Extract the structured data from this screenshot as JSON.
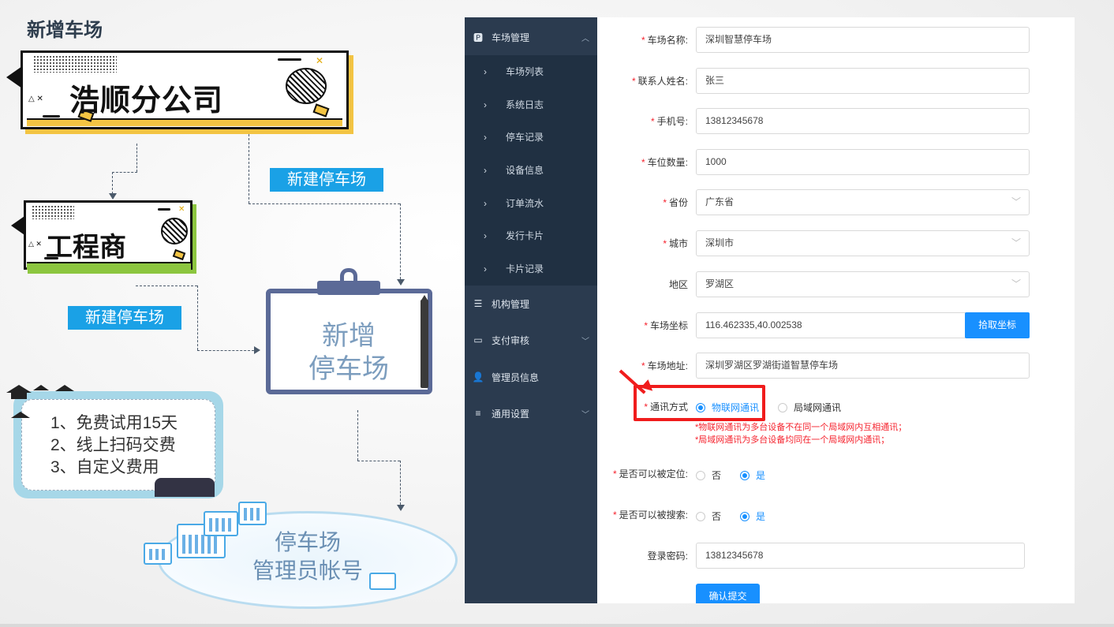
{
  "slide": {
    "title": "新增车场",
    "company_box": "浩顺分公司",
    "contractor_box": "工程商",
    "create_label_1": "新建停车场",
    "create_label_2": "新建停车场",
    "board_text_1": "新增",
    "board_text_2": "停车场",
    "features": [
      "1、免费试用15天",
      "2、线上扫码交费",
      "3、自定义费用"
    ],
    "admin_text_1": "停车场",
    "admin_text_2": "管理员帐号",
    "colors": {
      "blue_label": "#1aa1e6",
      "yellow_accent": "#f3c443",
      "green_accent": "#8cc63f",
      "highlight": "#f01c1c"
    }
  },
  "sidebar": {
    "groups": [
      {
        "label": "车场管理",
        "icon": "parking-icon",
        "expanded": true
      },
      {
        "label": "机构管理",
        "icon": "list-icon"
      },
      {
        "label": "支付审核",
        "icon": "card-icon"
      },
      {
        "label": "管理员信息",
        "icon": "user-icon"
      },
      {
        "label": "通用设置",
        "icon": "settings-icon"
      }
    ],
    "sub_items": [
      "车场列表",
      "系统日志",
      "停车记录",
      "设备信息",
      "订单流水",
      "发行卡片",
      "卡片记录"
    ]
  },
  "form": {
    "name_label": "车场名称:",
    "name_value": "深圳智慧停车场",
    "contact_label": "联系人姓名:",
    "contact_value": "张三",
    "phone_label": "手机号:",
    "phone_value": "13812345678",
    "spaces_label": "车位数量:",
    "spaces_value": "1000",
    "province_label": "省份",
    "province_value": "广东省",
    "city_label": "城市",
    "city_value": "深圳市",
    "district_label": "地区",
    "district_value": "罗湖区",
    "coord_label": "车场坐标",
    "coord_value": "116.462335,40.002538",
    "coord_button": "拾取坐标",
    "address_label": "车场地址:",
    "address_value": "深圳罗湖区罗湖街道智慧停车场",
    "comm_label": "通讯方式",
    "comm_option_1": "物联网通讯",
    "comm_option_2": "局域网通讯",
    "comm_selected": "物联网通讯",
    "comm_note_1": "*物联网通讯为多台设备不在同一个局域网内互相通讯；",
    "comm_note_2": "*局域网通讯为多台设备均同在一个局域网内通讯；",
    "locatable_label": "是否可以被定位:",
    "locatable_no": "否",
    "locatable_yes": "是",
    "locatable_selected": "是",
    "searchable_label": "是否可以被搜索:",
    "searchable_no": "否",
    "searchable_yes": "是",
    "searchable_selected": "是",
    "password_label": "登录密码:",
    "password_value": "13812345678",
    "submit_button": "确认提交",
    "colors": {
      "primary": "#1890ff",
      "required": "#f5222d",
      "sidebar_bg": "#2b3b4f"
    }
  }
}
